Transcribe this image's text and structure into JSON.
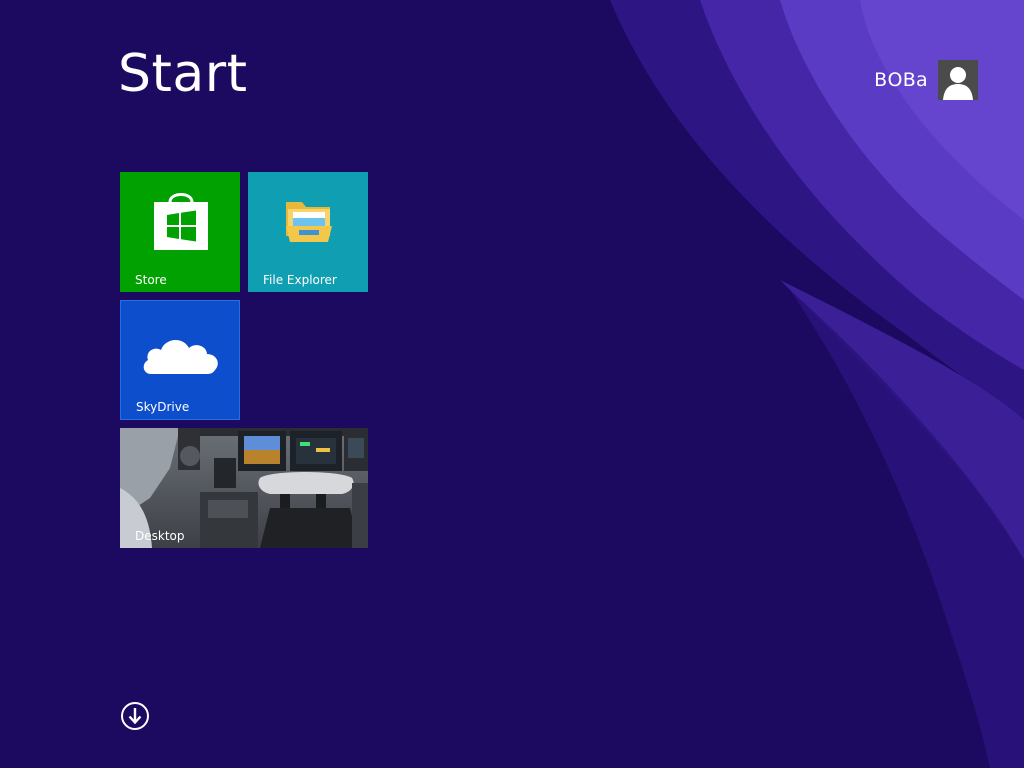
{
  "header": {
    "title": "Start",
    "user_name": "ВОВа"
  },
  "tiles": [
    {
      "label": "Store",
      "color": "#00a100",
      "icon": "store-bag-icon"
    },
    {
      "label": "File Explorer",
      "color": "#109fb2",
      "icon": "folder-icon"
    },
    {
      "label": "SkyDrive",
      "color": "#0c4ecb",
      "icon": "cloud-icon"
    },
    {
      "label": "Desktop",
      "color": "#5a5f66",
      "icon": "desktop-wallpaper"
    }
  ],
  "footer": {
    "all_apps_icon": "down-arrow-circle-icon"
  },
  "colors": {
    "background": "#1b0a5f",
    "accent_swirl": "#5b3bc7"
  }
}
